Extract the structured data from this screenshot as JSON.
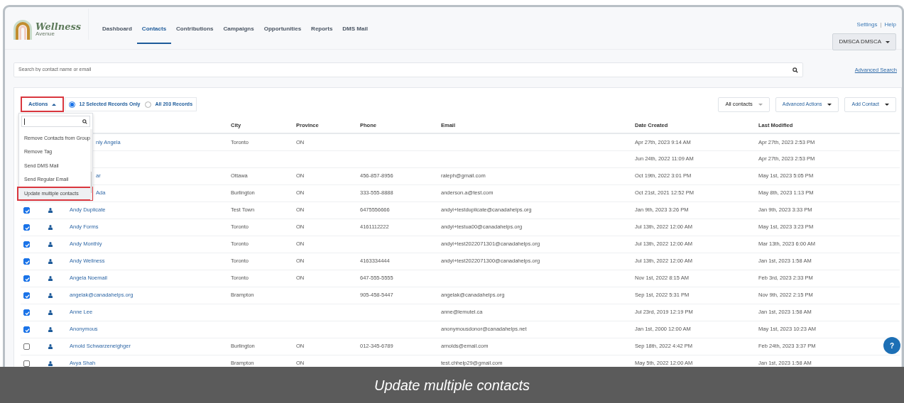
{
  "logo": {
    "title": "Wellness",
    "subtitle": "Avenue"
  },
  "nav": [
    {
      "label": "Dashboard",
      "selected": false
    },
    {
      "label": "Contacts",
      "selected": true
    },
    {
      "label": "Contributions",
      "selected": false
    },
    {
      "label": "Campaigns",
      "selected": false
    },
    {
      "label": "Opportunities",
      "selected": false
    },
    {
      "label": "Reports",
      "selected": false
    },
    {
      "label": "DMS Mail",
      "selected": false
    }
  ],
  "top_links": [
    "Settings",
    "|",
    "Help"
  ],
  "user_menu": {
    "label": "DMSCA DMSCA"
  },
  "search": {
    "placeholder": "Search by contact name or email"
  },
  "advanced_search": "Advanced Search",
  "toolbar": {
    "actions": {
      "label": "Actions",
      "highlighted": true,
      "expanded": true
    },
    "scope": [
      {
        "label": "12 Selected Records Only",
        "selected": true
      },
      {
        "label": "All 203 Records",
        "selected": false
      }
    ],
    "buttons": [
      {
        "label": "All contacts",
        "kind": "filter"
      },
      {
        "label": "Advanced Actions",
        "kind": "menu"
      },
      {
        "label": "Add Contact",
        "kind": "menu"
      }
    ]
  },
  "actions_menu": {
    "items": [
      {
        "label": "Remove Contacts from Group",
        "highlighted": false
      },
      {
        "label": "Remove Tag",
        "highlighted": false
      },
      {
        "label": "Send DMS Mail",
        "highlighted": false
      },
      {
        "label": "Send Regular Email",
        "highlighted": false
      },
      {
        "label": "Update multiple contacts",
        "highlighted": true
      }
    ]
  },
  "table": {
    "columns": [
      "City",
      "Province",
      "Phone",
      "Email",
      "Date Created",
      "Last Modified"
    ],
    "rows": [
      {
        "name": "nly Angela",
        "city": "Toronto",
        "province": "ON",
        "phone": "",
        "email": "",
        "created": "Apr 27th, 2023 9:14 AM",
        "modified": "Apr 27th, 2023 2:53 PM"
      },
      {
        "name": "",
        "city": "",
        "province": "",
        "phone": "",
        "email": "",
        "created": "Jun 24th, 2022 11:09 AM",
        "modified": "Apr 27th, 2023 2:53 PM"
      },
      {
        "name": "ar",
        "city": "Ottawa",
        "province": "ON",
        "phone": "456-857-8956",
        "email": "raleph@gmail.com",
        "created": "Oct 19th, 2022 3:01 PM",
        "modified": "May 1st, 2023 5:05 PM"
      },
      {
        "name": "Ada",
        "city": "Burlington",
        "province": "ON",
        "phone": "333-555-8888",
        "email": "anderson.a@test.com",
        "created": "Oct 21st, 2021 12:52 PM",
        "modified": "May 8th, 2023 1:13 PM"
      },
      {
        "checked": true,
        "name": "Andy Duplicate",
        "city": "Test Town",
        "province": "ON",
        "phone": "6475556666",
        "email": "andyl+testduplicate@canadahelps.org",
        "created": "Jan 9th, 2023 3:26 PM",
        "modified": "Jan 9th, 2023 3:33 PM"
      },
      {
        "checked": true,
        "name": "Andy Forms",
        "city": "Toronto",
        "province": "ON",
        "phone": "4161112222",
        "email": "andyl+testua00@canadahelps.org",
        "created": "Jul 13th, 2022 12:00 AM",
        "modified": "May 1st, 2023 3:23 PM"
      },
      {
        "checked": true,
        "name": "Andy Monthly",
        "city": "Toronto",
        "province": "ON",
        "phone": "",
        "email": "andyl+test2022071301@canadahelps.org",
        "created": "Jul 13th, 2022 12:00 AM",
        "modified": "Mar 13th, 2023 6:00 AM"
      },
      {
        "checked": true,
        "name": "Andy Wellness",
        "city": "Toronto",
        "province": "ON",
        "phone": "4163334444",
        "email": "andyl+test2022071300@canadahelps.org",
        "created": "Jul 13th, 2022 12:00 AM",
        "modified": "Jan 1st, 2023 1:58 AM"
      },
      {
        "checked": true,
        "name": "Angela Noemail",
        "city": "Toronto",
        "province": "ON",
        "phone": "647-555-5555",
        "email": "",
        "created": "Nov 1st, 2022 8:15 AM",
        "modified": "Feb 3rd, 2023 2:33 PM"
      },
      {
        "checked": true,
        "name": "angelak@canadahelps.org",
        "city": "Brampton",
        "province": "",
        "phone": "905-458-5447",
        "email": "angelak@canadahelps.org",
        "created": "Sep 1st, 2022 5:31 PM",
        "modified": "Nov 9th, 2022 2:15 PM"
      },
      {
        "checked": true,
        "name": "Anne Lee",
        "city": "",
        "province": "",
        "phone": "",
        "email": "anne@lemutel.ca",
        "created": "Jul 23rd, 2019 12:19 PM",
        "modified": "Jan 1st, 2023 1:58 AM"
      },
      {
        "checked": true,
        "name": "Anonymous",
        "city": "",
        "province": "",
        "phone": "",
        "email": "anonymousdonor@canadahelps.net",
        "created": "Jan 1st, 2000 12:00 AM",
        "modified": "May 1st, 2023 10:23 AM"
      },
      {
        "checked": false,
        "name": "Arnold Schwarzeneighger",
        "city": "Burlington",
        "province": "ON",
        "phone": "012-345-6789",
        "email": "arnolds@email.com",
        "created": "Sep 18th, 2022 4:42 PM",
        "modified": "Feb 24th, 2023 3:37 PM"
      },
      {
        "checked": false,
        "name": "Avya Shah",
        "city": "Brampton",
        "province": "ON",
        "phone": "",
        "email": "test.chhelp29@gmail.com",
        "created": "May 5th, 2022 12:00 AM",
        "modified": "Jan 1st, 2023 1:58 AM"
      }
    ]
  },
  "help_button": "?",
  "caption": "Update multiple contacts"
}
